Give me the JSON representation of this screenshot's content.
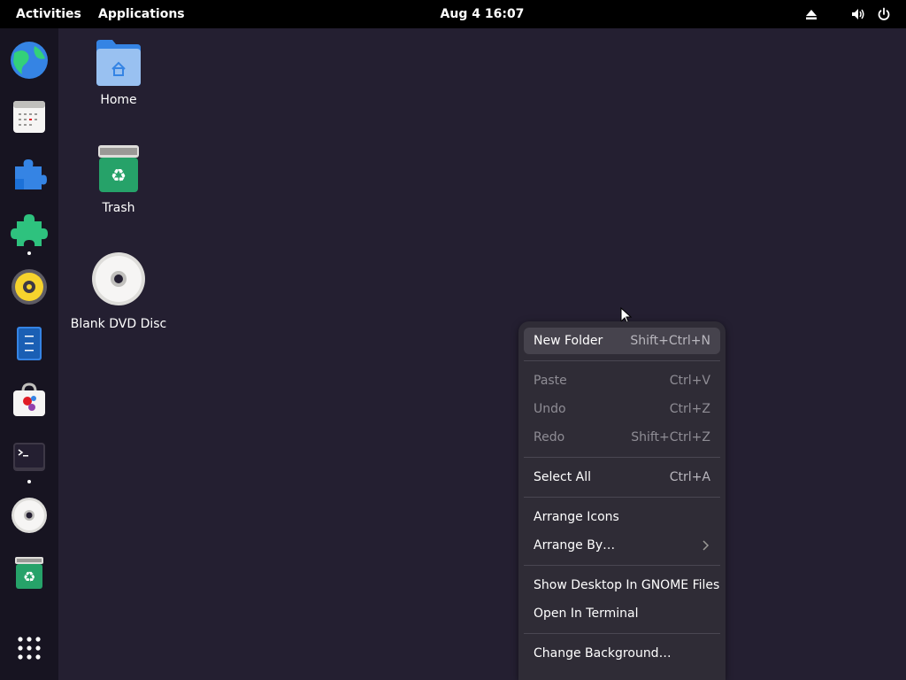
{
  "topbar": {
    "activities": "Activities",
    "applications": "Applications",
    "clock": "Aug 4  16:07",
    "icons": [
      "eject-icon",
      "volume-icon",
      "power-icon"
    ]
  },
  "dock": {
    "items": [
      "web-browser",
      "calendar",
      "extensions",
      "extension-manager",
      "rhythmbox",
      "text-editor",
      "software",
      "terminal",
      "dvd-disc",
      "trash",
      "app-grid"
    ]
  },
  "desktop": {
    "icons": [
      {
        "label": "Home",
        "icon": "folder-home-icon"
      },
      {
        "label": "Trash",
        "icon": "trash-icon"
      },
      {
        "label": "Blank DVD Disc",
        "icon": "dvd-icon"
      }
    ]
  },
  "menu": {
    "items": [
      {
        "label": "New Folder",
        "accel": "Shift+Ctrl+N"
      },
      {
        "label": "Paste",
        "accel": "Ctrl+V"
      },
      {
        "label": "Undo",
        "accel": "Ctrl+Z"
      },
      {
        "label": "Redo",
        "accel": "Shift+Ctrl+Z"
      },
      {
        "label": "Select All",
        "accel": "Ctrl+A"
      },
      {
        "label": "Arrange Icons",
        "accel": ""
      },
      {
        "label": "Arrange By…",
        "accel": ""
      },
      {
        "label": "Show Desktop In GNOME Files",
        "accel": ""
      },
      {
        "label": "Open In Terminal",
        "accel": ""
      },
      {
        "label": "Change Background…",
        "accel": ""
      }
    ]
  },
  "colors": {
    "background": "#241f31",
    "topbar": "#000000",
    "dock": "#171421",
    "menu": "#2f2c36",
    "accent_blue": "#3584e4",
    "trash_green": "#26a269"
  }
}
